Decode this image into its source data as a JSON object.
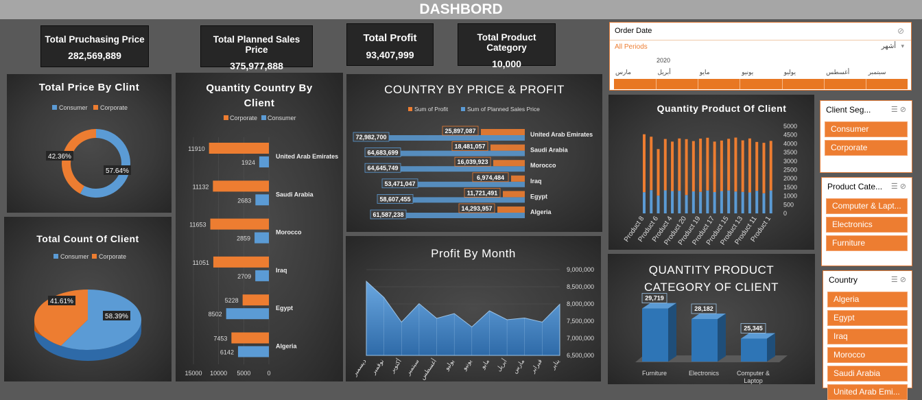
{
  "title": "DASHBORD",
  "kpis": {
    "purchasing": {
      "label": "Total Pruchasing Price",
      "value": "282,569,889"
    },
    "planned": {
      "label": "Total Planned Sales Price",
      "value": "375,977,888"
    },
    "profit": {
      "label": "Total Profit",
      "value": "93,407,999"
    },
    "category": {
      "label": "Total Product Category",
      "value": "10,000"
    }
  },
  "colors": {
    "consumer": "#5b9bd5",
    "corporate": "#ed7d31",
    "panel": "#404040"
  },
  "charts": {
    "total_price": {
      "title": "Total Price By Clint",
      "legend_consumer": "Consumer",
      "legend_corporate": "Corporate",
      "consumer_label": "57.64%",
      "corporate_label": "42.36%"
    },
    "count_client": {
      "title": "Total Count Of Client",
      "legend_consumer": "Consumer",
      "legend_corporate": "Corporate",
      "consumer_label": "58.39%",
      "corporate_label": "41.61%"
    },
    "qty_country": {
      "title1": "Quantity Country By",
      "title2": "Client",
      "legend_corporate": "Corporate",
      "legend_consumer": "Consumer",
      "countries": [
        "United Arab Emirates",
        "Saudi Arabia",
        "Morocco",
        "Iraq",
        "Egypt",
        "Algeria"
      ],
      "corporate": [
        11910,
        11132,
        11653,
        11051,
        5228,
        7453
      ],
      "consumer": [
        1924,
        2683,
        2859,
        2709,
        8502,
        6142
      ],
      "ticks": [
        "15000",
        "10000",
        "5000",
        "0"
      ]
    },
    "country_price": {
      "title": "COUNTRY BY PRICE & PROFIT",
      "legend_profit": "Sum of Profit",
      "legend_sales": "Sum of Planned Sales Price",
      "countries": [
        "United Arab Emirates",
        "Saudi Arabia",
        "Morocco",
        "Iraq",
        "Egypt",
        "Algeria"
      ],
      "sales": [
        "72,982,700",
        "64,683,699",
        "64,645,749",
        "53,471,047",
        "58,607,455",
        "61,587,238"
      ],
      "profit": [
        "25,897,087",
        "18,481,057",
        "16,039,923",
        "6,974,484",
        "11,721,491",
        "14,293,957"
      ]
    },
    "profit_month": {
      "title": "Profit By Month",
      "months": [
        "ديسمبر",
        "نوفمبر",
        "أكتوبر",
        "سبتمبر",
        "أغسطس",
        "يوليو",
        "يونيو",
        "مايو",
        "أبريل",
        "مارس",
        "فبراير",
        "يناير"
      ],
      "y_ticks": [
        "9,000,000",
        "8,500,000",
        "8,000,000",
        "7,500,000",
        "7,000,000",
        "6,500,000"
      ]
    },
    "qty_product": {
      "title": "Quantity Product Of Client",
      "products": [
        "Product 8",
        "Product 6",
        "Product 4",
        "Product 20",
        "Product 19",
        "Product 17",
        "Product 15",
        "Product 13",
        "Product 11",
        "Product 1"
      ],
      "y_ticks": [
        "5000",
        "4500",
        "4000",
        "3500",
        "3000",
        "2500",
        "2000",
        "1500",
        "1000",
        "500",
        "0"
      ]
    },
    "qty_category": {
      "title1": "QUANTITY PRODUCT",
      "title2": "CATEGORY OF CLIENT",
      "categories": [
        "Furniture",
        "Electronics",
        "Computer & Laptop"
      ],
      "values": [
        "29,719",
        "28,182",
        "25,345"
      ],
      "cat_line1": [
        "Furniture",
        "Electronics",
        "Computer &"
      ],
      "cat_line2": [
        "",
        "",
        "Laptop"
      ]
    }
  },
  "timeline": {
    "title": "Order Date",
    "period_label": "All Periods",
    "level": "أشهر",
    "year": "2020",
    "months": [
      "مارس",
      "أبريل",
      "مايو",
      "يونيو",
      "يوليو",
      "أغسطس",
      "سبتمبر"
    ]
  },
  "slicers": {
    "client_segment": {
      "title": "Client Seg...",
      "items": [
        "Consumer",
        "Corporate"
      ]
    },
    "product_category": {
      "title": "Product Cate...",
      "items": [
        "Computer & Lapt...",
        "Electronics",
        "Furniture"
      ]
    },
    "country": {
      "title": "Country",
      "items": [
        "Algeria",
        "Egypt",
        "Iraq",
        "Morocco",
        "Saudi Arabia",
        "United Arab Emi..."
      ]
    }
  }
}
